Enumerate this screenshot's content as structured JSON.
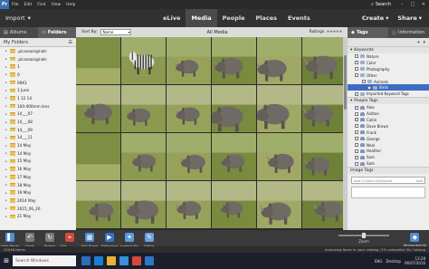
{
  "menubar": {
    "app_logo": "Pr",
    "items": [
      "File",
      "Edit",
      "Find",
      "View",
      "Help"
    ],
    "search_label": "Search",
    "window_controls": [
      "–",
      "□",
      "✕"
    ]
  },
  "topbar": {
    "import_label": "Import",
    "tabs": [
      "eLive",
      "Media",
      "People",
      "Places",
      "Events"
    ],
    "active_tab": "Media",
    "create_label": "Create",
    "share_label": "Share"
  },
  "left_panel": {
    "tabs": [
      "Albums",
      "Folders"
    ],
    "active_tab": "Folders",
    "header": "My Folders",
    "folders": [
      ".picasaoriginals",
      ".picasaoriginals",
      "1",
      "0",
      "06K1",
      "1 June",
      "1 12 14",
      "100-400mm lens",
      "14___07",
      "14___08",
      "14___09",
      "14___11",
      "14 May",
      "14 May",
      "15 May",
      "16 May",
      "17 May",
      "18 May",
      "19 May",
      "2014 May",
      "2015_06_26",
      "21 May"
    ]
  },
  "center": {
    "sort_label": "Sort By:",
    "sort_value": "Name",
    "title": "All Media",
    "ratings_label": "Ratings",
    "ratings_stars": "★★★★★"
  },
  "right_panel": {
    "tabs": [
      "Tags",
      "Information"
    ],
    "active_tab": "Tags",
    "sections": {
      "keywords": {
        "label": "Keywords",
        "items": [
          "Nature",
          "Color",
          "Photography",
          "Other"
        ],
        "sub_items": [
          "Animals"
        ],
        "sub2_items": [
          "Birds"
        ],
        "imported": "Imported Keyword Tags"
      },
      "people": {
        "label": "People Tags",
        "items": [
          "Alex",
          "Ashton",
          "Callie",
          "Dave Brown",
          "Frank",
          "George",
          "Neal",
          "Heather",
          "Sam",
          "Sam"
        ]
      },
      "image_tags": {
        "label": "Image Tags",
        "placeholder": "Add Custom Keywords",
        "add_label": "Add"
      }
    }
  },
  "bottom_bar": {
    "buttons": [
      {
        "label": "Hide Panel",
        "icon": "panel-icon",
        "color": "#4d8fd8"
      },
      {
        "label": "Undo",
        "icon": "undo-icon",
        "color": "#7a7a7a"
      },
      {
        "label": "Rotate",
        "icon": "rotate-icon",
        "color": "#7a7a7a"
      },
      {
        "label": "Add Location",
        "icon": "location-icon",
        "color": "#d24a3c"
      },
      {
        "label": "Add Event",
        "icon": "event-icon",
        "color": "#4d8fd8"
      },
      {
        "label": "Slideshow",
        "icon": "slideshow-icon",
        "color": "#2f75c8"
      },
      {
        "label": "Instant Fix",
        "icon": "instant-fix-icon",
        "color": "#5a9ce0"
      },
      {
        "label": "Editor",
        "icon": "editor-icon",
        "color": "#6aa2e0"
      }
    ],
    "zoom_label": "Zoom",
    "keyword_label": "Keywords/Info"
  },
  "status": {
    "left": "20048 Items",
    "right": "Analyzing faces in your catalog (1% complete)   My Catalog"
  },
  "taskbar": {
    "search_placeholder": "Search Windows",
    "tray": [
      "ENG",
      "Desktop"
    ],
    "time": "13:28",
    "date": "06/07/2016"
  },
  "thumbs": [
    [
      "grass",
      "zebra",
      "rhino",
      "rhino",
      "rhino",
      "rhino"
    ],
    [
      "rhino",
      "rhino",
      "rhino",
      "rhino",
      "rhino",
      "rhino"
    ],
    [
      "grass",
      "rhino",
      "rhino",
      "rhino",
      "rhino",
      "rhino"
    ],
    [
      "rhino",
      "rhino",
      "rhino",
      "rhino",
      "rhino",
      "rhino"
    ]
  ],
  "colors": {
    "accent": "#3d6cc2",
    "chrome_dark": "#313131",
    "grass": "#8a9a4a"
  }
}
